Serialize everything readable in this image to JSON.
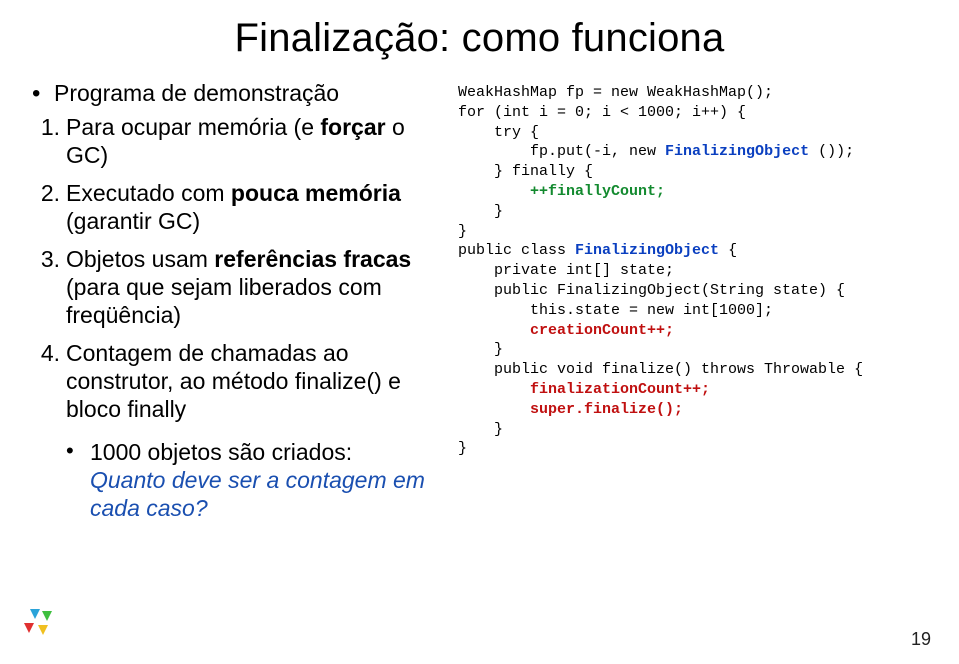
{
  "title": "Finalização: como funciona",
  "left": {
    "heading": "Programa de demonstração",
    "items": [
      {
        "num": "1.",
        "pre": "Para ocupar memória (e ",
        "bold": "forçar",
        "post": " o GC)"
      },
      {
        "num": "2.",
        "pre": "Executado com ",
        "bold": "pouca memória",
        "post": " (garantir GC)"
      },
      {
        "num": "3.",
        "pre": "Objetos usam ",
        "bold": "referências fracas",
        "post": " (para que sejam liberados com freqüência)"
      },
      {
        "num": "4.",
        "pre": "Contagem de chamadas ao construtor, ao método finalize() e bloco finally",
        "bold": "",
        "post": ""
      }
    ],
    "sub": {
      "line1": "1000 objetos são criados:",
      "line2_ital": "Quanto deve ser a contagem em cada caso?"
    }
  },
  "code": {
    "l01a": "WeakHashMap fp = new WeakHashMap();",
    "l02a": "for (int i = 0; i < 1000; i++) {",
    "l03a": "    try {",
    "l04a": "        fp.put(-i, new ",
    "l04b": "FinalizingObject",
    "l04c": " ());",
    "l05a": "    } finally {",
    "l06a": "        ",
    "l06b": "++finallyCount;",
    "l07a": "    }",
    "l08a": "}",
    "l09a": "public class ",
    "l09b": "FinalizingObject",
    "l09c": " {",
    "l10a": "    private int[] state;",
    "l11a": "    public FinalizingObject(String state) {",
    "l12a": "        this.state = new int[1000];",
    "l13a": "        ",
    "l13b": "creationCount++;",
    "l14a": "    }",
    "l15a": "    public void finalize() throws Throwable {",
    "l16a": "        ",
    "l16b": "finalizationCount++;",
    "l17a": "        ",
    "l17b": "super.finalize();",
    "l18a": "    }",
    "l19a": "}"
  },
  "pagenum": "19"
}
